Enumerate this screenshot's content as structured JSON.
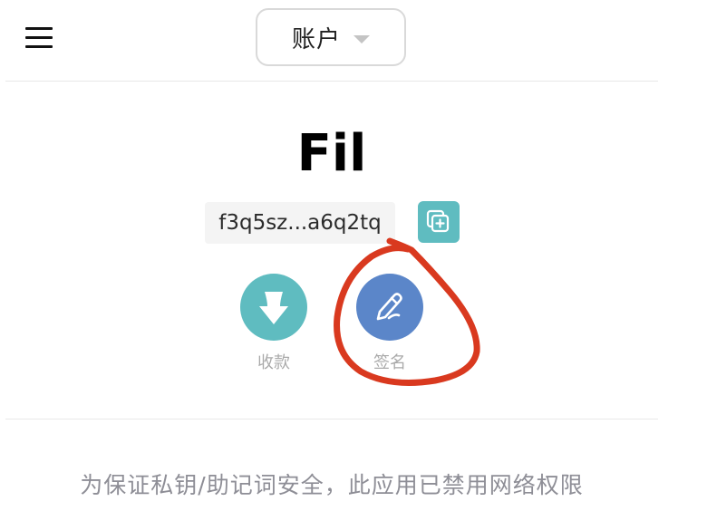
{
  "header": {
    "account_label": "账户"
  },
  "coin": {
    "name": "Fil",
    "address_short": "f3q5sz...a6q2tq"
  },
  "actions": {
    "receive_label": "收款",
    "sign_label": "签名"
  },
  "footer": {
    "notice": "为保证私钥/助记词安全，此应用已禁用网络权限"
  },
  "icons": {
    "menu": "hamburger-menu-icon",
    "dropdown": "chevron-down-icon",
    "copy": "copy-icon",
    "receive": "arrow-down-icon",
    "sign": "pen-icon"
  },
  "colors": {
    "teal": "#5fbcc0",
    "blue": "#5b86c9",
    "annotation_red": "#d9391f",
    "muted_text": "#a9a9a9"
  }
}
